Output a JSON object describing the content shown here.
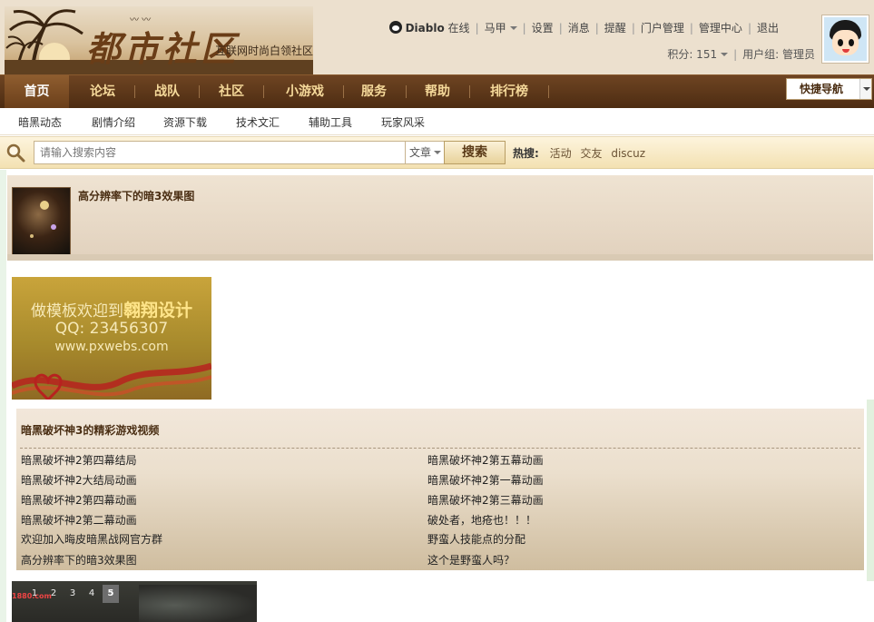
{
  "header": {
    "logo_title": "都市社区",
    "logo_subtitle": "互联网时尚白领社区",
    "user": {
      "name": "Diablo",
      "online_status": "在线",
      "vest_label": "马甲",
      "links": [
        "设置",
        "消息",
        "提醒",
        "门户管理",
        "管理中心",
        "退出"
      ],
      "points_label": "积分: 151",
      "group_label": "用户组: 管理员"
    }
  },
  "main_nav": {
    "items": [
      "首页",
      "论坛",
      "战队",
      "社区",
      "小游戏",
      "服务",
      "帮助",
      "排行榜"
    ],
    "active_index": 0,
    "quick_nav_label": "快捷导航"
  },
  "sub_nav": {
    "items": [
      "暗黑动态",
      "剧情介绍",
      "资源下载",
      "技术文汇",
      "辅助工具",
      "玩家风采"
    ]
  },
  "search": {
    "placeholder": "请输入搜索内容",
    "type_label": "文章",
    "button_label": "搜索",
    "hot_label": "热搜:",
    "hot_terms": [
      "活动",
      "交友",
      "discuz"
    ]
  },
  "featured": {
    "title": "高分辨率下的暗3效果图"
  },
  "banner": {
    "line1_prefix": "做模板欢迎到",
    "line1_brand": "翱翔设计",
    "line2": "QQ: 23456307",
    "line3": "www.pxwebs.com"
  },
  "video_section": {
    "title": "暗黑破坏神3的精彩游戏视频",
    "left_links": [
      "暗黑破坏神2第四幕结局",
      "暗黑破坏神2大结局动画",
      "暗黑破坏神2第四幕动画",
      "暗黑破坏神2第二幕动画",
      "欢迎加入晦皮暗黑战网官方群",
      "高分辨率下的暗3效果图"
    ],
    "right_links": [
      "暗黑破坏神2第五幕动画",
      "暗黑破坏神2第一幕动画",
      "暗黑破坏神2第三幕动画",
      "破处者，地疮也！！！",
      "野蛮人技能点的分配",
      "这个是野蛮人吗？"
    ]
  },
  "slider": {
    "logo_text": "1880.com",
    "pages": [
      "1",
      "2",
      "3",
      "4",
      "5"
    ],
    "active_page": "5"
  },
  "colors": {
    "nav_bg": "#5a3518",
    "nav_text": "#f5d99a",
    "header_bg": "#ece0ce",
    "search_bg": "#f6e6bd",
    "accent_text": "#4a2e13"
  }
}
